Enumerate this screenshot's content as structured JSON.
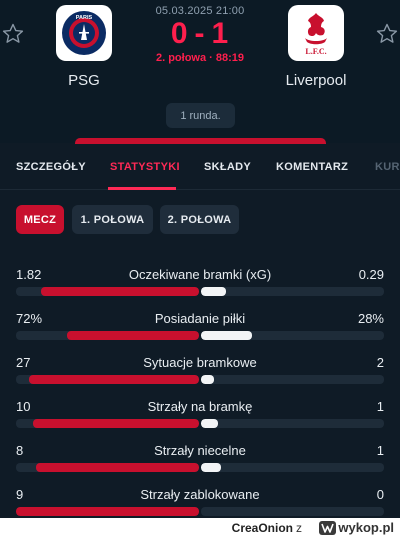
{
  "match": {
    "datetime": "05.03.2025 21:00",
    "home_score": "0",
    "separator": "-",
    "away_score": "1",
    "status": "2. połowa · 88:19",
    "round": "1 runda."
  },
  "home_team": {
    "name": "PSG",
    "crest_text": "PARIS",
    "crest_icon": "psg-crest"
  },
  "away_team": {
    "name": "Liverpool",
    "crest_text": "L.F.C.",
    "crest_icon": "liverpool-crest"
  },
  "tabs": [
    {
      "label": "SZCZEGÓŁY",
      "active": false
    },
    {
      "label": "STATYSTYKI",
      "active": true
    },
    {
      "label": "SKŁADY",
      "active": false
    },
    {
      "label": "KOMENTARZ",
      "active": false
    },
    {
      "label": "KUR",
      "active": false
    }
  ],
  "periods": [
    {
      "label": "MECZ",
      "active": true
    },
    {
      "label": "1. POŁOWA",
      "active": false
    },
    {
      "label": "2. POŁOWA",
      "active": false
    }
  ],
  "stats": [
    {
      "name": "Oczekiwane bramki (xG)",
      "home": "1.82",
      "away": "0.29",
      "home_share": 0.862,
      "away_share": 0.138
    },
    {
      "name": "Posiadanie piłki",
      "home": "72%",
      "away": "28%",
      "home_share": 0.72,
      "away_share": 0.28
    },
    {
      "name": "Sytuacje bramkowe",
      "home": "27",
      "away": "2",
      "home_share": 0.931,
      "away_share": 0.069
    },
    {
      "name": "Strzały na bramkę",
      "home": "10",
      "away": "1",
      "home_share": 0.909,
      "away_share": 0.091
    },
    {
      "name": "Strzały niecelne",
      "home": "8",
      "away": "1",
      "home_share": 0.889,
      "away_share": 0.111
    },
    {
      "name": "Strzały zablokowane",
      "home": "9",
      "away": "0",
      "home_share": 1.0,
      "away_share": 0.0
    }
  ],
  "footer": {
    "author": "CreaOnion",
    "connector": "z",
    "site": "wykop.pl"
  },
  "colors": {
    "accent": "#ff1f4d",
    "home_bar": "#c8102e",
    "away_bar": "#f2f4f6",
    "background": "#0f1b26"
  }
}
